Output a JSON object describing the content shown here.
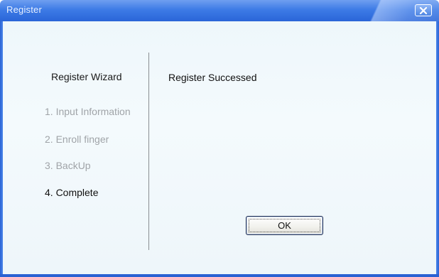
{
  "window": {
    "title": "Register"
  },
  "wizard": {
    "title": "Register Wizard",
    "steps": [
      {
        "label": "1. Input Information",
        "state": "inactive"
      },
      {
        "label": "2. Enroll finger",
        "state": "inactive"
      },
      {
        "label": "3. BackUp",
        "state": "inactive"
      },
      {
        "label": "4. Complete",
        "state": "current"
      }
    ]
  },
  "content": {
    "message": "Register Successed"
  },
  "buttons": {
    "ok_label": "OK"
  },
  "icons": {
    "close": "close-icon"
  },
  "colors": {
    "titlebar": "#3d7be6",
    "client_background": "#eef7fb",
    "inactive_step": "#a0a4a8",
    "active_text": "#111111"
  }
}
